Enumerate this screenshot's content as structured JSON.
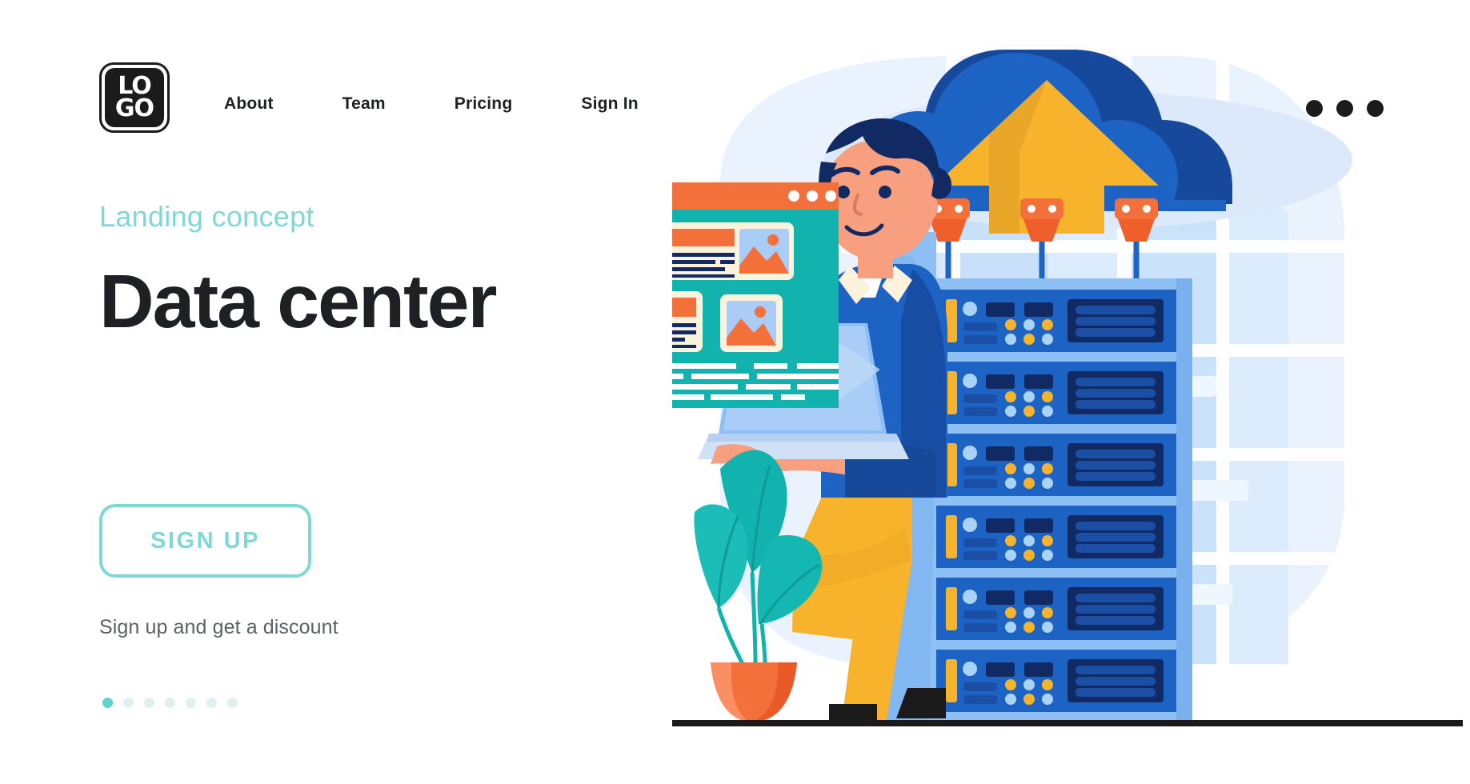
{
  "brand": {
    "logo_line1": "LO",
    "logo_line2": "GO",
    "logo_alt": "LOGO"
  },
  "header": {
    "nav": [
      {
        "label": "About"
      },
      {
        "label": "Team"
      },
      {
        "label": "Pricing"
      },
      {
        "label": "Sign In"
      }
    ],
    "overflow_menu": "···"
  },
  "hero": {
    "eyebrow": "Landing concept",
    "headline": "Data center",
    "cta_label": "SIGN UP",
    "cta_note": "Sign up and get a discount",
    "carousel": {
      "total": 7,
      "active_index": 0
    }
  },
  "colors": {
    "accent_teal": "#7ed9d4",
    "dot_active": "#5ed3cc",
    "dot_inactive": "#e2efef",
    "ink": "#1f2024",
    "muted": "#5d6066",
    "illustration_blue": "#1c63c4",
    "illustration_dark_blue": "#17499b",
    "illustration_navy": "#122a63",
    "illustration_light_blue": "#8ec0f5",
    "illustration_pale_blue": "#d9e9fb",
    "illustration_orange": "#f4703a",
    "illustration_yellow": "#f7b32b",
    "illustration_teal": "#12b2ae",
    "illustration_cream": "#fdf3dd",
    "illustration_skin": "#f79f7f"
  },
  "illustration": {
    "name": "data-center-scene",
    "elements": [
      "cloud-upload-icon",
      "plug-cables",
      "server-rack",
      "person-with-laptop",
      "browser-window-mockup",
      "potted-plant",
      "background-buildings",
      "ground-line"
    ],
    "browser_window": {
      "close_glyph": "×",
      "traffic_dots": 3,
      "cards": 4
    },
    "server_rack": {
      "units": 6
    },
    "cloud": {
      "arrow_direction": "up",
      "cable_count": 3
    }
  }
}
